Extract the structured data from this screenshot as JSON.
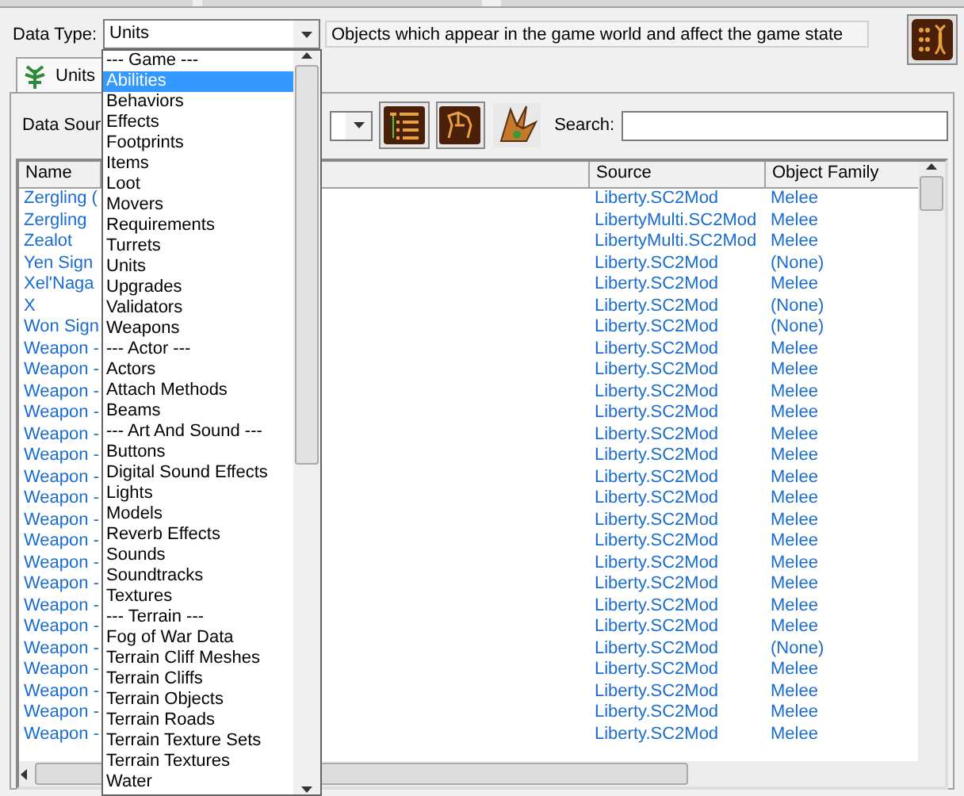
{
  "data_type": {
    "label": "Data Type:",
    "value": "Units",
    "description": "Objects which appear in the game world and affect the game state"
  },
  "data_type_list": {
    "items": [
      {
        "text": "--- Game ---",
        "selected": false
      },
      {
        "text": "Abilities",
        "selected": true
      },
      {
        "text": "Behaviors",
        "selected": false
      },
      {
        "text": "Effects",
        "selected": false
      },
      {
        "text": "Footprints",
        "selected": false
      },
      {
        "text": "Items",
        "selected": false
      },
      {
        "text": "Loot",
        "selected": false
      },
      {
        "text": "Movers",
        "selected": false
      },
      {
        "text": "Requirements",
        "selected": false
      },
      {
        "text": "Turrets",
        "selected": false
      },
      {
        "text": "Units",
        "selected": false
      },
      {
        "text": "Upgrades",
        "selected": false
      },
      {
        "text": "Validators",
        "selected": false
      },
      {
        "text": "Weapons",
        "selected": false
      },
      {
        "text": "--- Actor ---",
        "selected": false
      },
      {
        "text": "Actors",
        "selected": false
      },
      {
        "text": "Attach Methods",
        "selected": false
      },
      {
        "text": "Beams",
        "selected": false
      },
      {
        "text": "--- Art And Sound ---",
        "selected": false
      },
      {
        "text": "Buttons",
        "selected": false
      },
      {
        "text": "Digital Sound Effects",
        "selected": false
      },
      {
        "text": "Lights",
        "selected": false
      },
      {
        "text": "Models",
        "selected": false
      },
      {
        "text": "Reverb Effects",
        "selected": false
      },
      {
        "text": "Sounds",
        "selected": false
      },
      {
        "text": "Soundtracks",
        "selected": false
      },
      {
        "text": "Textures",
        "selected": false
      },
      {
        "text": "--- Terrain ---",
        "selected": false
      },
      {
        "text": "Fog of War Data",
        "selected": false
      },
      {
        "text": "Terrain Cliff Meshes",
        "selected": false
      },
      {
        "text": "Terrain Cliffs",
        "selected": false
      },
      {
        "text": "Terrain Objects",
        "selected": false
      },
      {
        "text": "Terrain Roads",
        "selected": false
      },
      {
        "text": "Terrain Texture Sets",
        "selected": false
      },
      {
        "text": "Terrain Textures",
        "selected": false
      },
      {
        "text": "Water",
        "selected": false
      }
    ]
  },
  "tabs": [
    {
      "label": "Units",
      "selected": true
    }
  ],
  "data_source": {
    "label": "Data Sour"
  },
  "search": {
    "label": "Search:"
  },
  "table": {
    "columns": [
      "Name",
      "Source",
      "Object Family"
    ],
    "rows": [
      {
        "name": "Zergling (",
        "source": "Liberty.SC2Mod",
        "object_family": "Melee"
      },
      {
        "name": "Zergling",
        "source": "LibertyMulti.SC2Mod",
        "object_family": "Melee"
      },
      {
        "name": "Zealot",
        "source": "LibertyMulti.SC2Mod",
        "object_family": "Melee"
      },
      {
        "name": "Yen Sign",
        "source": "Liberty.SC2Mod",
        "object_family": "(None)"
      },
      {
        "name": "Xel'Naga",
        "source": "Liberty.SC2Mod",
        "object_family": "Melee"
      },
      {
        "name": "X",
        "source": "Liberty.SC2Mod",
        "object_family": "(None)"
      },
      {
        "name": "Won Sign",
        "source": "Liberty.SC2Mod",
        "object_family": "(None)"
      },
      {
        "name": "Weapon -",
        "source": "Liberty.SC2Mod",
        "object_family": "Melee"
      },
      {
        "name": "Weapon -",
        "source": "Liberty.SC2Mod",
        "object_family": "Melee"
      },
      {
        "name": "Weapon -",
        "source": "Liberty.SC2Mod",
        "object_family": "Melee"
      },
      {
        "name": "Weapon -",
        "source": "Liberty.SC2Mod",
        "object_family": "Melee"
      },
      {
        "name": "Weapon -",
        "source": "Liberty.SC2Mod",
        "object_family": "Melee"
      },
      {
        "name": "Weapon -",
        "source": "Liberty.SC2Mod",
        "object_family": "Melee"
      },
      {
        "name": "Weapon -",
        "source": "Liberty.SC2Mod",
        "object_family": "Melee"
      },
      {
        "name": "Weapon -",
        "source": "Liberty.SC2Mod",
        "object_family": "Melee"
      },
      {
        "name": "Weapon -",
        "source": "Liberty.SC2Mod",
        "object_family": "Melee"
      },
      {
        "name": "Weapon -",
        "source": "Liberty.SC2Mod",
        "object_family": "Melee"
      },
      {
        "name": "Weapon -",
        "source": "Liberty.SC2Mod",
        "object_family": "Melee"
      },
      {
        "name": "Weapon -",
        "source": "Liberty.SC2Mod",
        "object_family": "Melee"
      },
      {
        "name": "Weapon -",
        "source": "Liberty.SC2Mod",
        "object_family": "Melee"
      },
      {
        "name": "Weapon -",
        "source": "Liberty.SC2Mod",
        "object_family": "Melee"
      },
      {
        "name": "Weapon -",
        "source": "Liberty.SC2Mod",
        "object_family": "(None)"
      },
      {
        "name": "Weapon -",
        "source": "Liberty.SC2Mod",
        "object_family": "Melee"
      },
      {
        "name": "Weapon -",
        "source": "Liberty.SC2Mod",
        "object_family": "Melee"
      },
      {
        "name": "Weapon -",
        "source": "Liberty.SC2Mod",
        "object_family": "Melee"
      },
      {
        "name": "Weapon -",
        "source": "Liberty.SC2Mod",
        "object_family": "Melee"
      }
    ]
  }
}
